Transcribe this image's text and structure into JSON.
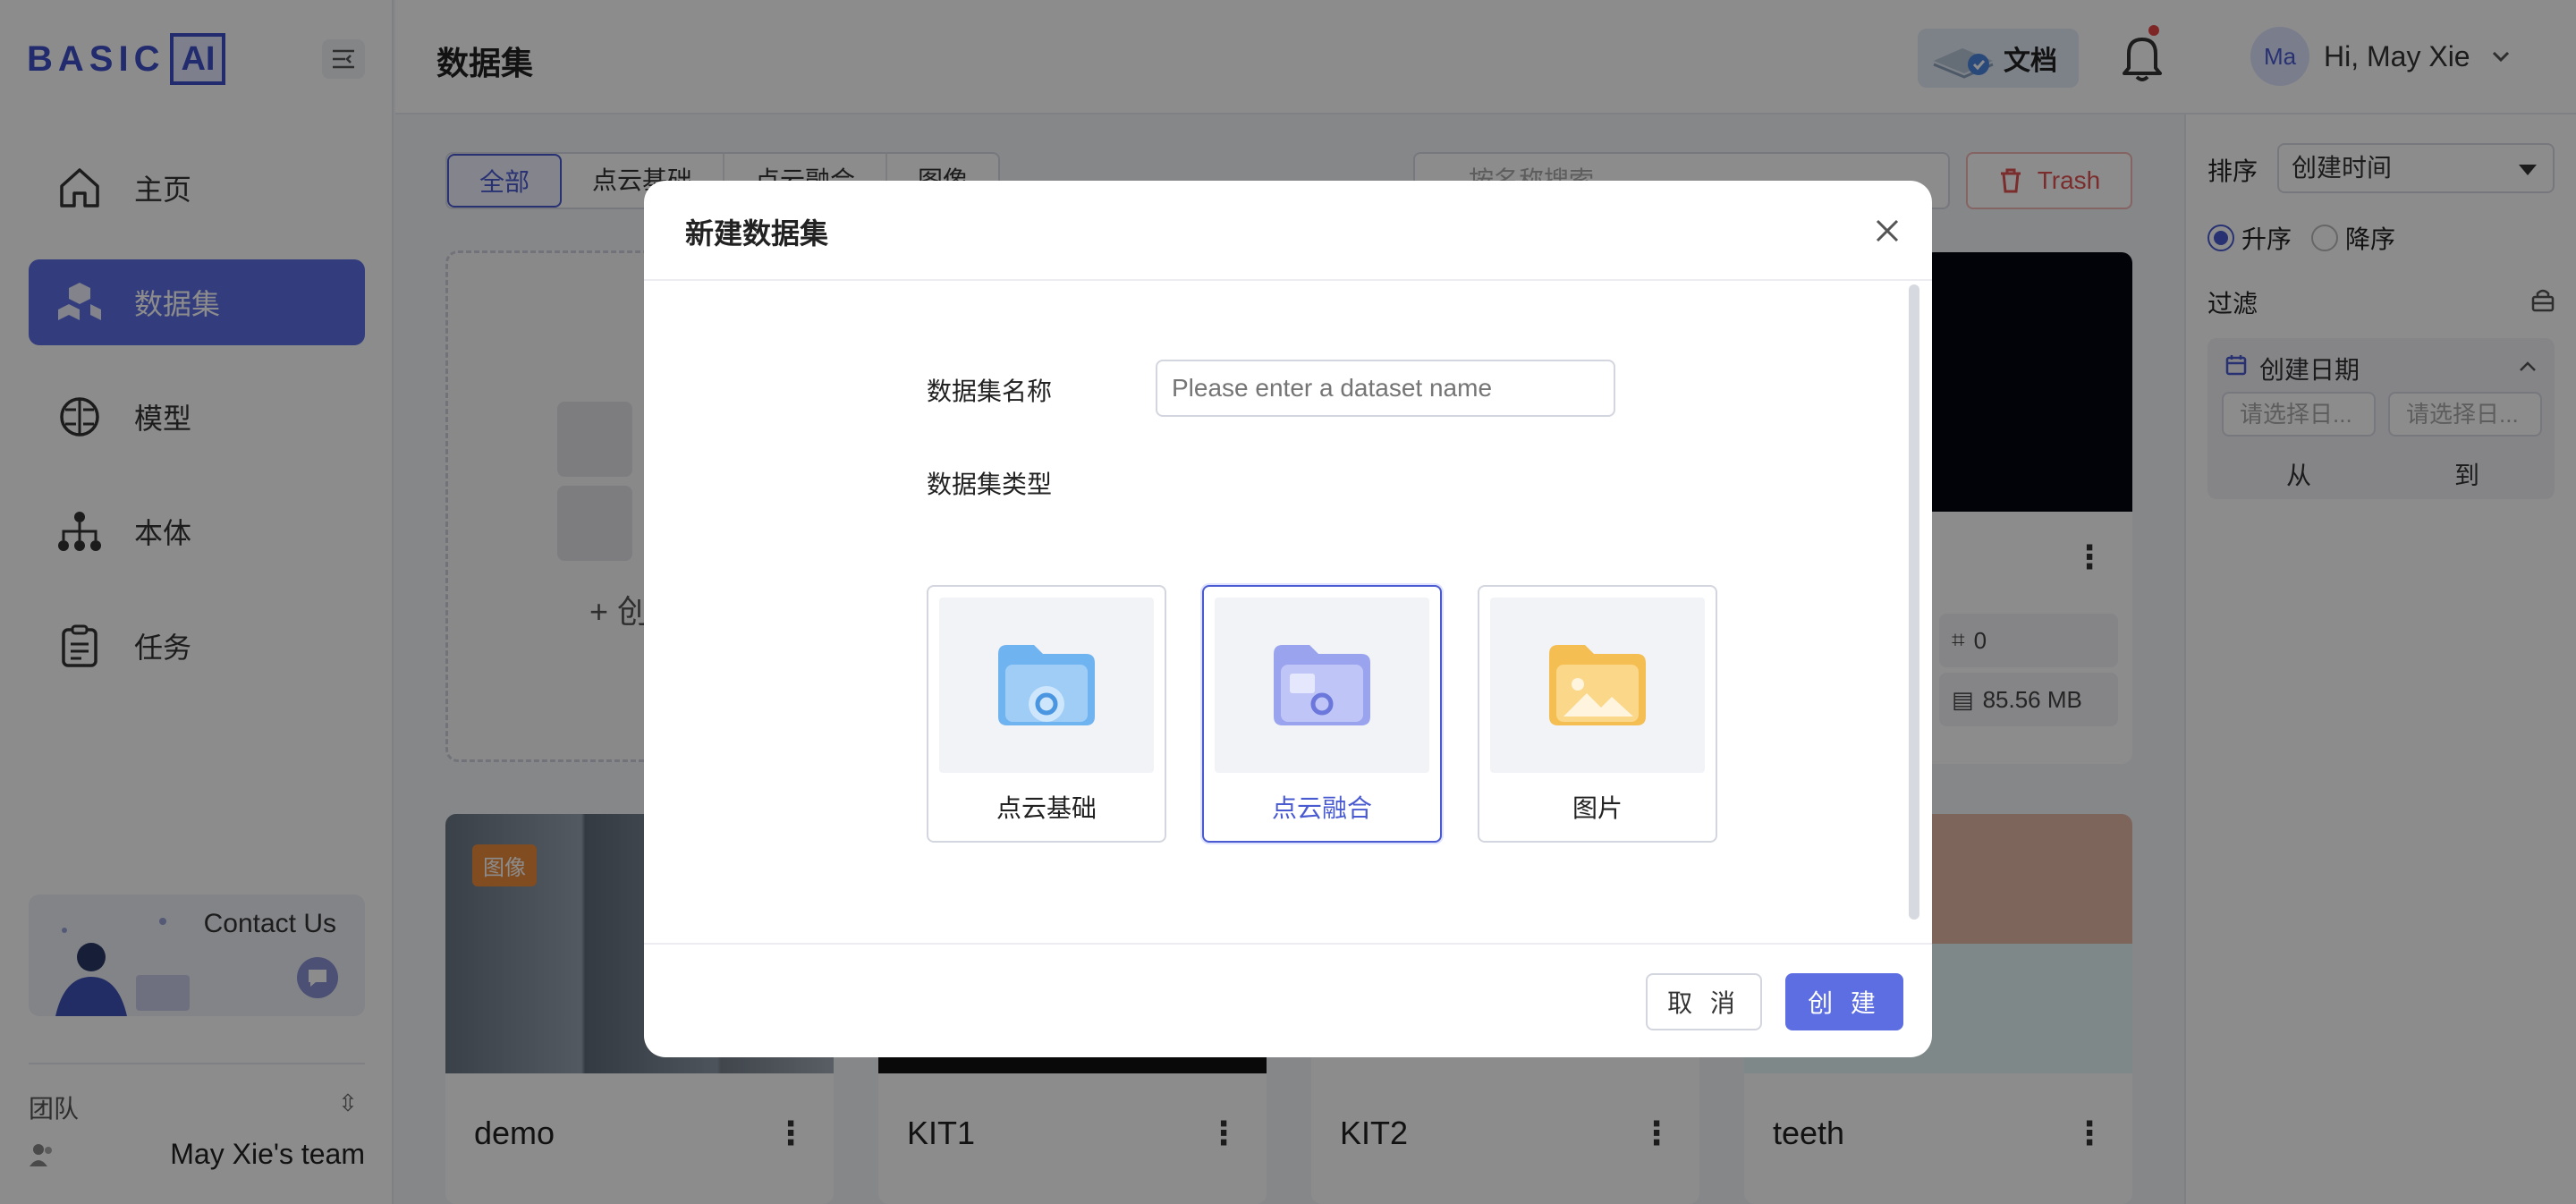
{
  "brand": {
    "logo_text": "BASIC",
    "logo_box": "AI"
  },
  "header": {
    "title": "数据集",
    "docs_label": "文档",
    "user_initials": "Ma",
    "greeting": "Hi, May Xie"
  },
  "sidebar": {
    "items": [
      {
        "label": "主页",
        "icon": "home-icon"
      },
      {
        "label": "数据集",
        "icon": "dataset-cubes-icon",
        "active": true
      },
      {
        "label": "模型",
        "icon": "brain-model-icon"
      },
      {
        "label": "本体",
        "icon": "ontology-tree-icon"
      },
      {
        "label": "任务",
        "icon": "task-clipboard-icon"
      }
    ],
    "contact": "Contact Us",
    "team_label": "团队",
    "team_name": "May Xie's team"
  },
  "main": {
    "tabs": [
      "全部",
      "点云基础",
      "点云融合",
      "图像"
    ],
    "search_placeholder": "按名称搜索",
    "trash_label": "Trash",
    "create_label": "+ 创",
    "cards": [
      {
        "title": "demo",
        "badge": "图像"
      },
      {
        "title": "KIT1"
      },
      {
        "title": "KIT2"
      },
      {
        "title": "teeth"
      }
    ],
    "partial_card": {
      "annotations": "0",
      "size": "85.56 MB"
    }
  },
  "right_panel": {
    "sort_label": "排序",
    "sort_value": "创建时间",
    "asc": "升序",
    "desc": "降序",
    "filter_label": "过滤",
    "date_title": "创建日期",
    "date_from_placeholder": "请选择日...",
    "date_to_placeholder": "请选择日...",
    "from": "从",
    "to": "到"
  },
  "modal": {
    "title": "新建数据集",
    "name_label": "数据集名称",
    "name_placeholder": "Please enter a dataset name",
    "type_label": "数据集类型",
    "types": [
      {
        "label": "点云基础",
        "icon": "pointcloud-folder-icon"
      },
      {
        "label": "点云融合",
        "icon": "fusion-folder-icon",
        "selected": true
      },
      {
        "label": "图片",
        "icon": "image-folder-icon"
      }
    ],
    "cancel": "取 消",
    "create": "创 建"
  },
  "colors": {
    "accent": "#5d6ee3",
    "accent_text": "#4a5bd1",
    "danger": "#e05252"
  }
}
